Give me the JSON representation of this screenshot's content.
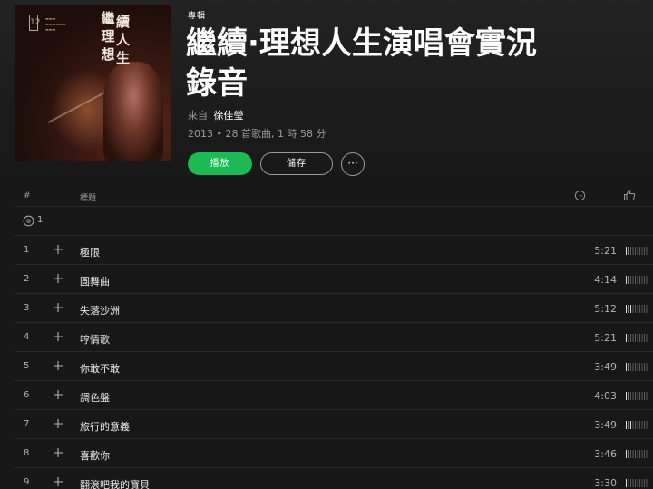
{
  "album": {
    "type_label": "專輯",
    "title_line1": "繼續·理想人生演唱會實況",
    "title_line2": "錄音",
    "from_label": "來自",
    "artist": "徐佳瑩",
    "meta": "2013 • 28 首歌曲, 1 時 58 分",
    "cover_art_text": "繼續理想人生"
  },
  "actions": {
    "play_label": "播放",
    "save_label": "儲存",
    "more_label": "···"
  },
  "table": {
    "col_number": "#",
    "col_title": "標題",
    "disc_number": "1"
  },
  "tracks": [
    {
      "number": "1",
      "title": "極限",
      "duration": "5:21",
      "popularity": 0.2
    },
    {
      "number": "2",
      "title": "圓舞曲",
      "duration": "4:14",
      "popularity": 0.2
    },
    {
      "number": "3",
      "title": "失落沙洲",
      "duration": "5:12",
      "popularity": 0.3
    },
    {
      "number": "4",
      "title": "哼情歌",
      "duration": "5:21",
      "popularity": 0.1
    },
    {
      "number": "5",
      "title": "你敢不敢",
      "duration": "3:49",
      "popularity": 0.2
    },
    {
      "number": "6",
      "title": "調色盤",
      "duration": "4:03",
      "popularity": 0.2
    },
    {
      "number": "7",
      "title": "旅行的意義",
      "duration": "3:49",
      "popularity": 0.3
    },
    {
      "number": "8",
      "title": "喜歡你",
      "duration": "3:46",
      "popularity": 0.2
    },
    {
      "number": "9",
      "title": "翻滾吧我的寶貝",
      "duration": "3:30",
      "popularity": 0.1
    }
  ]
}
